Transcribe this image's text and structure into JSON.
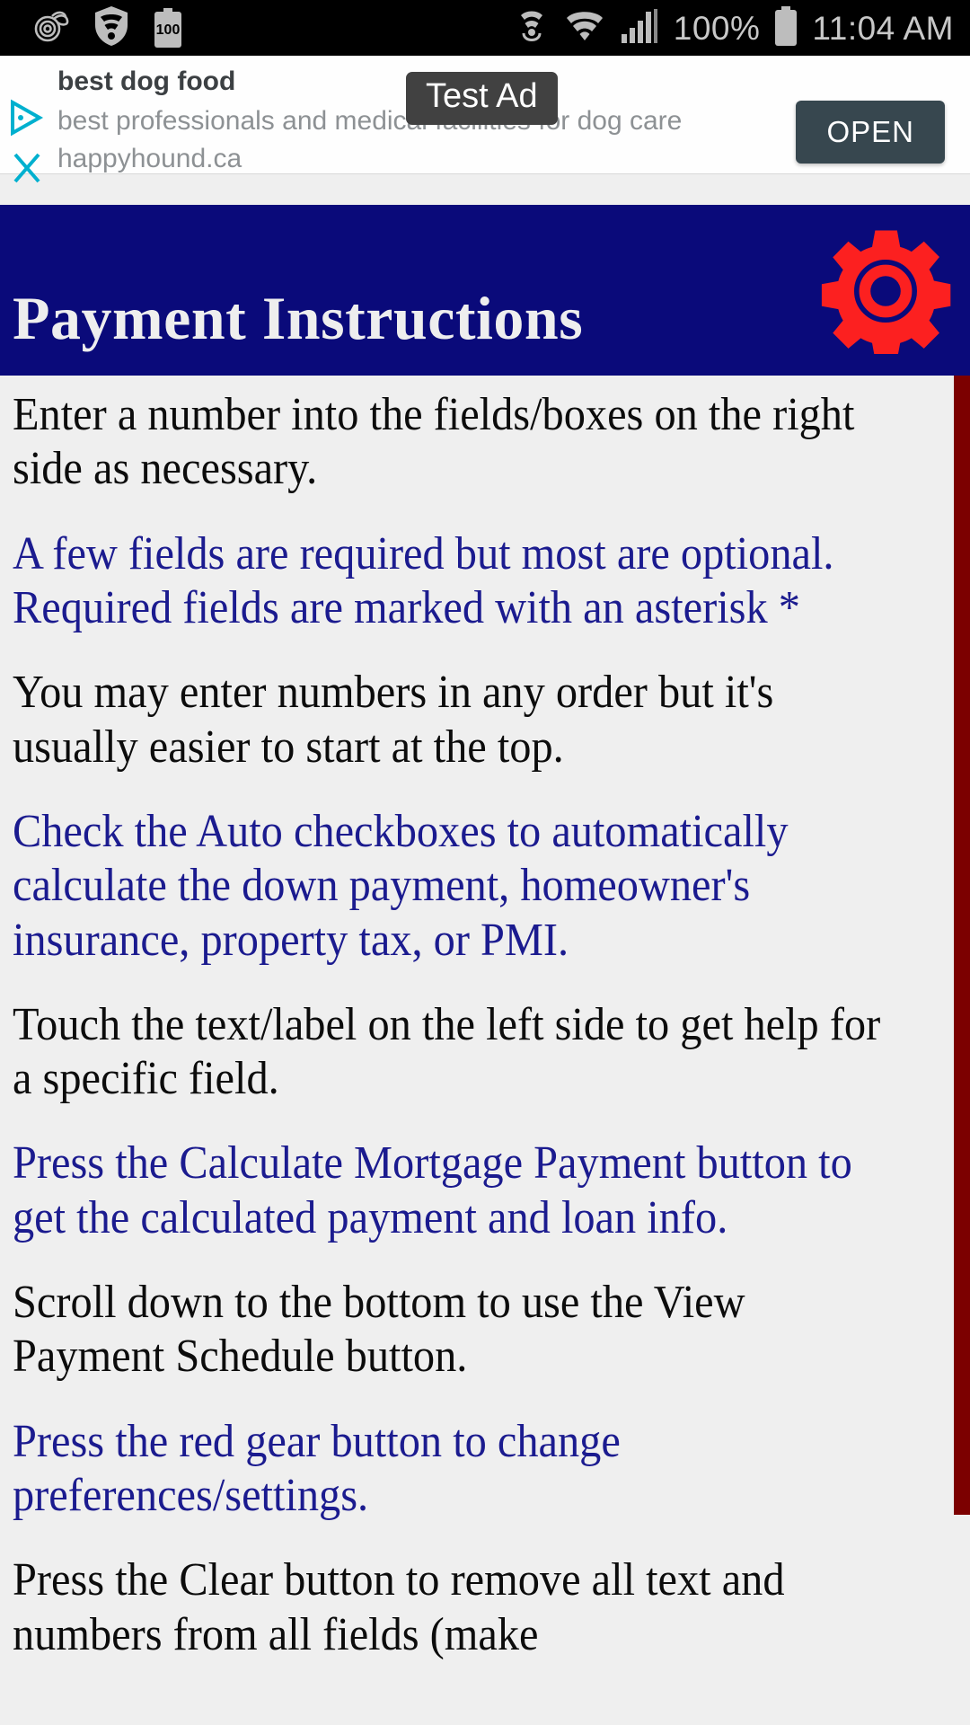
{
  "statusbar": {
    "battery_label": "100",
    "battery_percent": "100%",
    "time": "11:04 AM",
    "icons_left": [
      "swirl-logo-icon",
      "shield-wifi-icon",
      "battery-saver-icon"
    ],
    "icons_right": [
      "nfc-icon",
      "wifi-icon",
      "cellular-signal-icon",
      "battery-icon"
    ]
  },
  "ad": {
    "badge": "Test Ad",
    "title": "best dog food",
    "description": "best professionals and medical facilities for dog care",
    "url": "happyhound.ca",
    "open_label": "OPEN",
    "adchoices_icon": "ad-triangle-icon",
    "close_icon": "close-x-icon"
  },
  "header": {
    "title": "Payment Instructions",
    "gear_icon": "gear-icon",
    "background_color": "#0a0a7a",
    "gear_color": "#fc2020"
  },
  "content": {
    "paragraphs": [
      {
        "text": "Enter a number into the fields/boxes on the right side as necessary.",
        "color": "black"
      },
      {
        "text": "A few fields are required but most are optional. Required fields are marked with an asterisk *",
        "color": "blue"
      },
      {
        "text": "You may enter numbers in any order but it's usually easier to start at the top.",
        "color": "black"
      },
      {
        "text": "Check the Auto checkboxes to automatically calculate the down payment, homeowner's insurance, property tax, or PMI.",
        "color": "blue"
      },
      {
        "text": "Touch the text/label on the left side to get help for a specific field.",
        "color": "black"
      },
      {
        "text": "Press the Calculate Mortgage Payment button to get the calculated payment and loan info.",
        "color": "blue"
      },
      {
        "text": "Scroll down to the bottom to use the View Payment Schedule button.",
        "color": "black"
      },
      {
        "text": "Press the red gear button to change preferences/settings.",
        "color": "blue"
      },
      {
        "text": "Press the Clear button to remove all text and numbers from all fields (make",
        "color": "black"
      }
    ],
    "text_color_black": "#0c0c0c",
    "text_color_blue": "#1b1b8f",
    "background_color": "#efefef"
  },
  "scrollbar": {
    "color": "#7c0000"
  }
}
